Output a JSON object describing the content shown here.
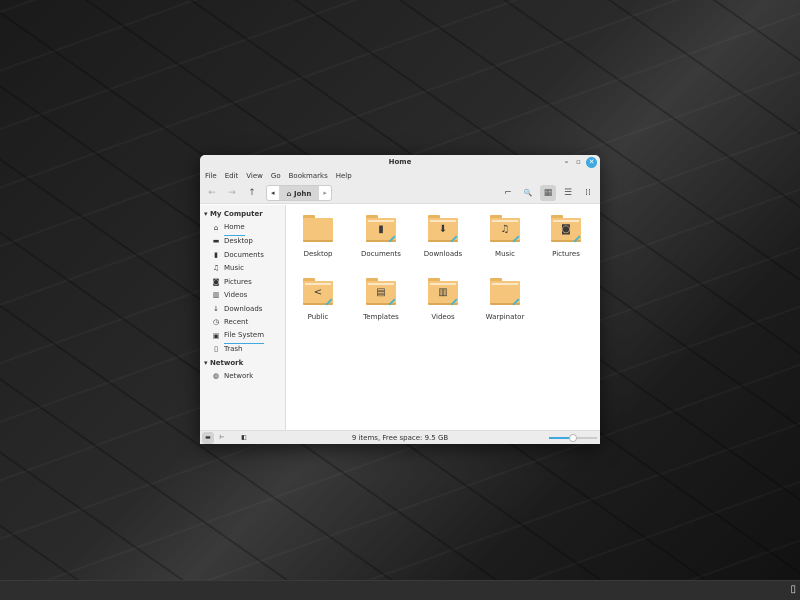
{
  "window": {
    "title": "Home",
    "minimize": "–",
    "maximize": "▫",
    "close": "✕"
  },
  "menu": [
    "File",
    "Edit",
    "View",
    "Go",
    "Bookmarks",
    "Help"
  ],
  "toolbar": {
    "back": "←",
    "forward": "→",
    "up": "↑",
    "path_prev": "◂",
    "crumb": "John",
    "path_next": "▸",
    "terminal": "⌐",
    "search": "🔍",
    "icon_view": "▦",
    "list_view": "☰",
    "compact_view": "⁞⁞"
  },
  "sidebar": {
    "sections": [
      {
        "title": "My Computer",
        "items": [
          {
            "label": "Home",
            "icon": "⌂"
          },
          {
            "label": "Desktop",
            "icon": "▬"
          },
          {
            "label": "Documents",
            "icon": "▮"
          },
          {
            "label": "Music",
            "icon": "♫"
          },
          {
            "label": "Pictures",
            "icon": "◙"
          },
          {
            "label": "Videos",
            "icon": "▥"
          },
          {
            "label": "Downloads",
            "icon": "↓"
          },
          {
            "label": "Recent",
            "icon": "◷"
          },
          {
            "label": "File System",
            "icon": "▣"
          },
          {
            "label": "Trash",
            "icon": "▯"
          }
        ]
      },
      {
        "title": "Network",
        "items": [
          {
            "label": "Network",
            "icon": "◍"
          }
        ]
      }
    ],
    "arrow": "▾"
  },
  "files": [
    {
      "name": "Desktop",
      "emblem": ""
    },
    {
      "name": "Documents",
      "emblem": "▮"
    },
    {
      "name": "Downloads",
      "emblem": "⬇"
    },
    {
      "name": "Music",
      "emblem": "♫"
    },
    {
      "name": "Pictures",
      "emblem": "◙"
    },
    {
      "name": "Public",
      "emblem": "<"
    },
    {
      "name": "Templates",
      "emblem": "▤"
    },
    {
      "name": "Videos",
      "emblem": "▥"
    },
    {
      "name": "Warpinator",
      "emblem": ""
    }
  ],
  "status": {
    "text": "9 items, Free space: 9.5 GB",
    "zoom_level": 0.5,
    "places_btn": "▬",
    "tree_btn": "⊢",
    "toggle_btn": "◧"
  },
  "panel": {
    "show_desktop": "▯"
  },
  "colors": {
    "accent": "#3ea8e0",
    "folder": "#f4c57a"
  }
}
